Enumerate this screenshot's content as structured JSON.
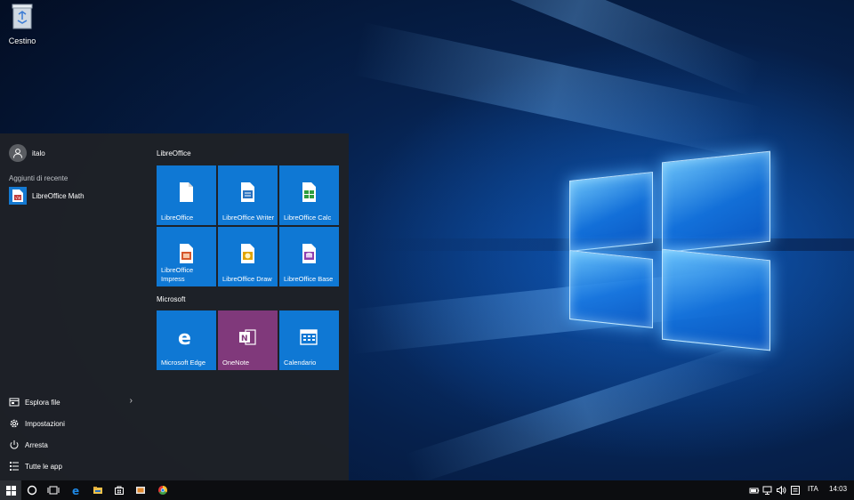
{
  "desktop": {
    "recycle_bin_label": "Cestino"
  },
  "start_menu": {
    "user_name": "italo",
    "recent_label": "Aggiunti di recente",
    "recent_items": [
      {
        "label": "LibreOffice Math",
        "icon": "libreoffice-math-icon"
      }
    ],
    "bottom_items": [
      {
        "label": "Esplora file",
        "icon": "file-explorer-icon",
        "has_chevron": true
      },
      {
        "label": "Impostazioni",
        "icon": "gear-icon"
      },
      {
        "label": "Arresta",
        "icon": "power-icon"
      },
      {
        "label": "Tutte le app",
        "icon": "all-apps-icon"
      }
    ],
    "groups": [
      {
        "label": "LibreOffice",
        "tiles": [
          {
            "label": "LibreOffice",
            "icon": "libreoffice-icon",
            "color": "#0f78d4"
          },
          {
            "label": "LibreOffice Writer",
            "icon": "writer-icon",
            "color": "#0f78d4"
          },
          {
            "label": "LibreOffice Calc",
            "icon": "calc-icon",
            "color": "#0f78d4"
          },
          {
            "label": "LibreOffice Impress",
            "icon": "impress-icon",
            "color": "#0f78d4"
          },
          {
            "label": "LibreOffice Draw",
            "icon": "draw-icon",
            "color": "#0f78d4"
          },
          {
            "label": "LibreOffice Base",
            "icon": "base-icon",
            "color": "#0f78d4"
          }
        ]
      },
      {
        "label": "Microsoft",
        "tiles": [
          {
            "label": "Microsoft Edge",
            "icon": "edge-icon",
            "color": "#0f78d4"
          },
          {
            "label": "OneNote",
            "icon": "onenote-icon",
            "color": "#80397b"
          },
          {
            "label": "Calendario",
            "icon": "calendar-icon",
            "color": "#0f78d4"
          }
        ]
      }
    ]
  },
  "taskbar": {
    "pinned": [
      "start-icon",
      "cortana-icon",
      "task-view-icon",
      "edge-icon",
      "file-explorer-icon",
      "store-icon",
      "media-icon",
      "chrome-icon"
    ],
    "tray": [
      "battery-icon",
      "network-icon",
      "volume-icon",
      "notifications-icon"
    ],
    "language": "ITA",
    "time": "14:03"
  },
  "colors": {
    "accent": "#0f78d4",
    "onenote": "#80397b",
    "start_bg": "#1e2126"
  }
}
